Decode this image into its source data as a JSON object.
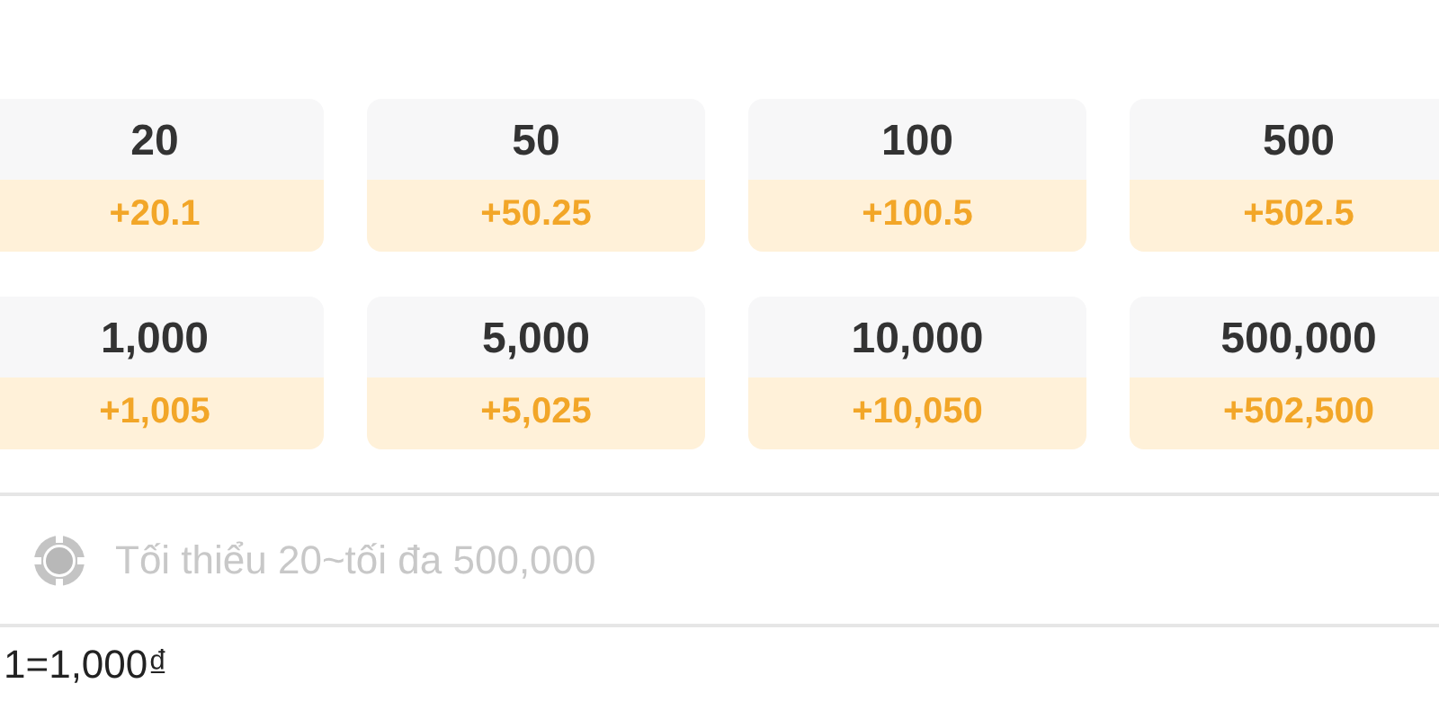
{
  "options": [
    {
      "amount": "20",
      "bonus": "+20.1"
    },
    {
      "amount": "50",
      "bonus": "+50.25"
    },
    {
      "amount": "100",
      "bonus": "+100.5"
    },
    {
      "amount": "500",
      "bonus": "+502.5"
    },
    {
      "amount": "1,000",
      "bonus": "+1,005"
    },
    {
      "amount": "5,000",
      "bonus": "+5,025"
    },
    {
      "amount": "10,000",
      "bonus": "+10,050"
    },
    {
      "amount": "500,000",
      "bonus": "+502,500"
    }
  ],
  "amount_field": {
    "placeholder": "Tối thiểu 20~tối đa 500,000"
  },
  "rate_note": "1=1,000₫"
}
